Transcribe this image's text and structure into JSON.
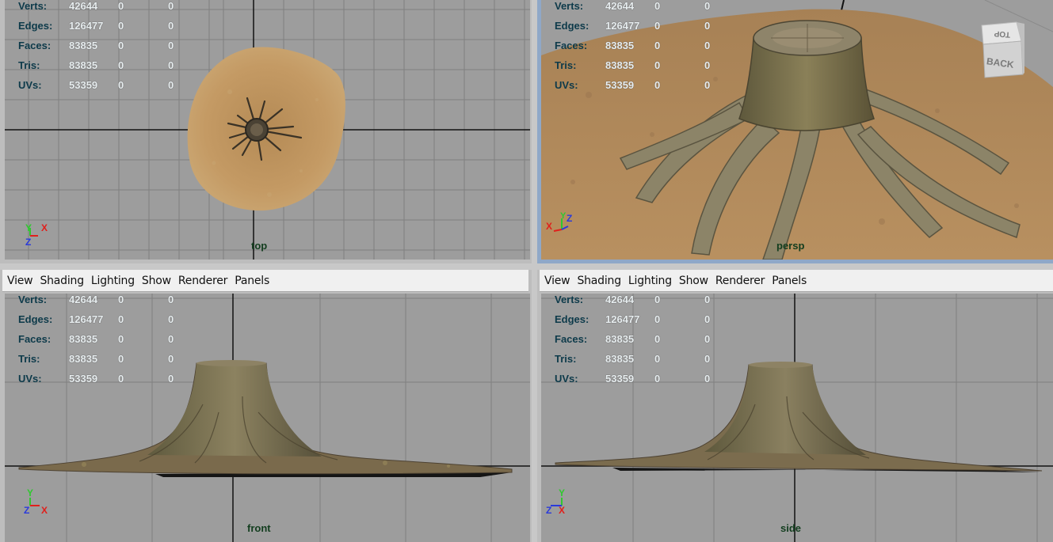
{
  "menus": [
    "View",
    "Shading",
    "Lighting",
    "Show",
    "Renderer",
    "Panels"
  ],
  "hud": {
    "labels": [
      "Verts:",
      "Edges:",
      "Faces:",
      "Tris:",
      "UVs:"
    ],
    "values": [
      "42644",
      "126477",
      "83835",
      "83835",
      "53359"
    ],
    "col2": [
      "0",
      "0",
      "0",
      "0",
      "0"
    ],
    "col3": [
      "0",
      "0",
      "0",
      "0",
      "0"
    ]
  },
  "views": {
    "top": "top",
    "persp": "persp",
    "front": "front",
    "side": "side"
  },
  "viewcube": {
    "top_face": "TOP",
    "back_face": "BACK"
  },
  "axes": {
    "x": "X",
    "y": "Y",
    "z": "Z"
  },
  "colors": {
    "viewport_bg": "#9d9d9d",
    "grid": "#7f7f7f",
    "axis_line": "#111111",
    "x_axis": "#e0201c",
    "y_axis": "#30c830",
    "z_axis": "#2a3adc",
    "active_border": "#8fa8c8"
  }
}
